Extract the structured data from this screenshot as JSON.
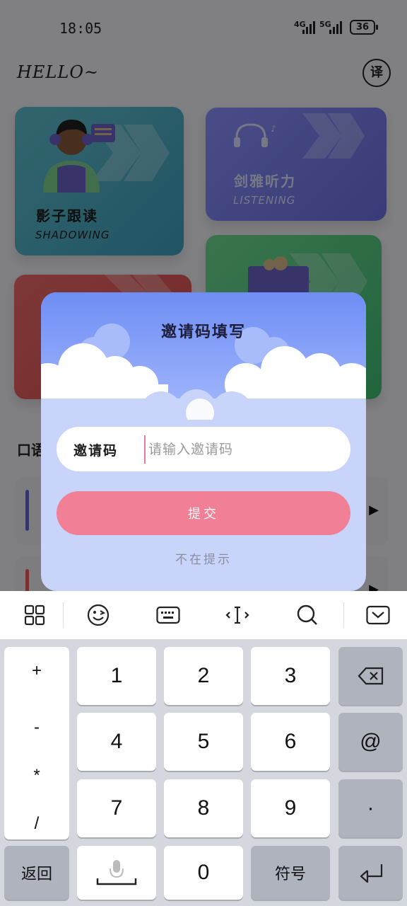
{
  "status": {
    "time": "18:05",
    "network1": "4G",
    "network2": "5G",
    "battery": "36"
  },
  "header": {
    "greeting": "HELLO~",
    "translate_label": "译"
  },
  "cards": {
    "shadowing": {
      "title": "影子跟读",
      "subtitle": "SHADOWING"
    },
    "listening": {
      "title": "剑雅听力",
      "subtitle": "LISTENING"
    }
  },
  "section": {
    "title_fragment": "口语"
  },
  "modal": {
    "title": "邀请码填写",
    "field_label": "邀请码",
    "field_placeholder": "请输入邀请码",
    "field_value": "",
    "submit_label": "提交",
    "dismiss_label": "不在提示"
  },
  "keyboard": {
    "symbols": [
      "+",
      "-",
      "*",
      "/"
    ],
    "digits": [
      "1",
      "2",
      "3",
      "4",
      "5",
      "6",
      "7",
      "8",
      "9",
      "0"
    ],
    "at_key": "@",
    "dot_key": "·",
    "back_key": "返回",
    "symbol_key": "符号"
  },
  "colors": {
    "accent_pink": "#f17f95",
    "modal_blue": "#6e8ef5",
    "dim_overlay": "rgba(0,0,0,0.47)"
  }
}
